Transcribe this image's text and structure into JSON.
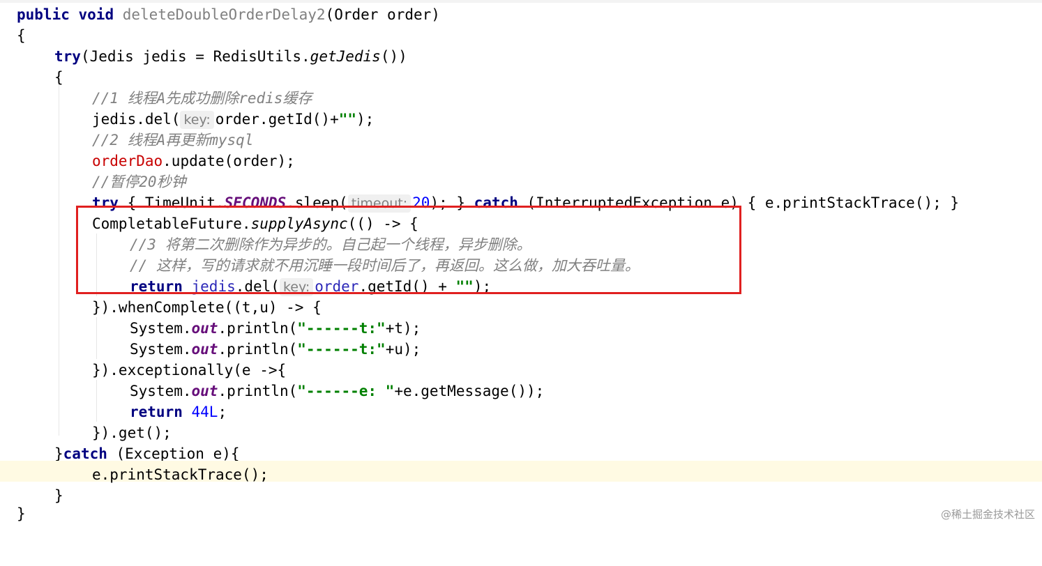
{
  "code": {
    "l1": {
      "kw1": "public",
      "kw2": "void",
      "method": "deleteDoubleOrderDelay2",
      "rest": "(Order order)"
    },
    "l2": {
      "brace": "{"
    },
    "l3": {
      "kw": "try",
      "a": "(Jedis jedis = RedisUtils.",
      "m": "getJedis",
      "b": "())"
    },
    "l4": {
      "brace": "{"
    },
    "l5": {
      "comment": "//1 线程A先成功删除redis缓存"
    },
    "l6": {
      "a": "jedis.del(",
      "hint": "key:",
      "b": "order.getId()+",
      "s": "\"\"",
      "c": ");"
    },
    "l7": {
      "comment": "//2 线程A再更新mysql"
    },
    "l8": {
      "field": "orderDao",
      "rest": ".update(order);"
    },
    "l9": {
      "comment": "//暂停20秒钟"
    },
    "l10": {
      "kw1": "try",
      "a": " { TimeUnit.",
      "f": "SECONDS",
      "b": ".sleep(",
      "hint": "timeout:",
      "n": "20",
      "c": "); } ",
      "kw2": "catch",
      "d": " (InterruptedException e) { e.printStackTrace(); }"
    },
    "l11": {
      "a": "CompletableFuture.",
      "m": "supplyAsync",
      "b": "(() -> {"
    },
    "l12": {
      "comment": "//3 将第二次删除作为异步的。自己起一个线程，异步删除。"
    },
    "l13": {
      "comment": "// 这样，写的请求就不用沉睡一段时间后了，再返回。这么做，加大吞吐量。"
    },
    "l14": {
      "kw": "return",
      "v1": "jedis",
      "a": ".del(",
      "hint": "key:",
      "v2": "order",
      "b": ".getId() + ",
      "s": "\"\"",
      "c": ");"
    },
    "l15": {
      "a": "}).whenComplete((t,u) -> {"
    },
    "l16": {
      "a": "System.",
      "f": "out",
      "b": ".println(",
      "s": "\"------t:\"",
      "c": "+t);"
    },
    "l17": {
      "a": "System.",
      "f": "out",
      "b": ".println(",
      "s": "\"------t:\"",
      "c": "+u);"
    },
    "l18": {
      "a": "}).exceptionally(e ->{"
    },
    "l19": {
      "a": "System.",
      "f": "out",
      "b": ".println(",
      "s": "\"------e: \"",
      "c": "+e.getMessage());"
    },
    "l20": {
      "kw": "return",
      "n": "44L",
      "c": ";"
    },
    "l21": {
      "a": "}).get();"
    },
    "l22": {
      "a": "}",
      "kw": "catch",
      "b": " (Exception e){"
    },
    "l23": {
      "a": "e.printStackTrace();"
    },
    "l24": {
      "a": "}"
    },
    "l25": {
      "a": "}"
    }
  },
  "watermark": "@稀土掘金技术社区",
  "colors": {
    "highlight_box": "#e02020",
    "keyword": "#000080",
    "string": "#008000",
    "comment": "#808080",
    "field": "#660e7a",
    "current_line": "#fffae3"
  }
}
